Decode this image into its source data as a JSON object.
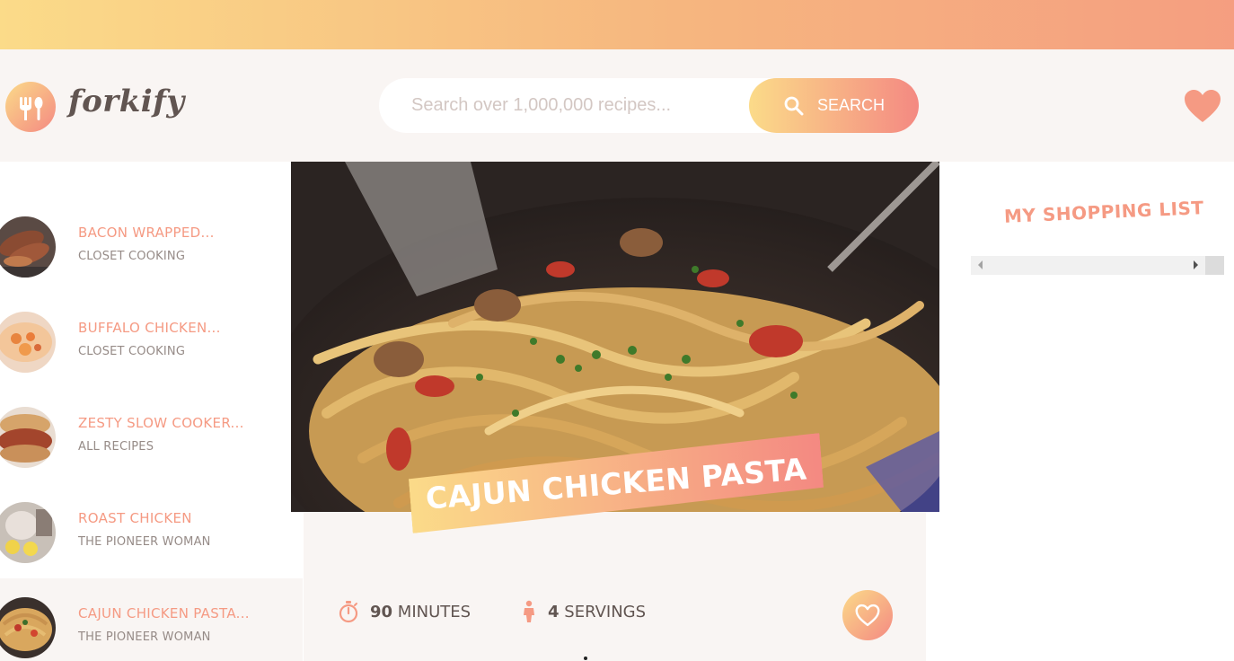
{
  "brand": {
    "name": "forkify",
    "logo_icon": "fork-spoon-icon"
  },
  "search": {
    "placeholder": "Search over 1,000,000 recipes...",
    "button_label": "SEARCH",
    "icon": "search-icon"
  },
  "header": {
    "likes_icon": "heart-icon"
  },
  "results": [
    {
      "title": "BACON WRAPPED...",
      "author": "CLOSET COOKING",
      "active": false
    },
    {
      "title": "BUFFALO CHICKEN...",
      "author": "CLOSET COOKING",
      "active": false
    },
    {
      "title": "ZESTY SLOW COOKER...",
      "author": "ALL RECIPES",
      "active": false
    },
    {
      "title": "ROAST CHICKEN",
      "author": "THE PIONEER WOMAN",
      "active": false
    },
    {
      "title": "CAJUN CHICKEN PASTA...",
      "author": "THE PIONEER WOMAN",
      "active": true
    }
  ],
  "recipe": {
    "title": "CAJUN CHICKEN PASTA",
    "minutes": "90",
    "minutes_label": "MINUTES",
    "servings": "4",
    "servings_label": "SERVINGS",
    "time_icon": "stopwatch-icon",
    "servings_icon": "person-icon",
    "like_icon": "heart-outline-icon"
  },
  "shopping": {
    "title": "MY SHOPPING LIST"
  },
  "colors": {
    "primary_light": "#fbdb89",
    "primary_dark": "#f48982",
    "accent_text": "#f59a83",
    "text": "#615551",
    "muted": "#968b87",
    "panel_bg": "#f9f5f3"
  }
}
